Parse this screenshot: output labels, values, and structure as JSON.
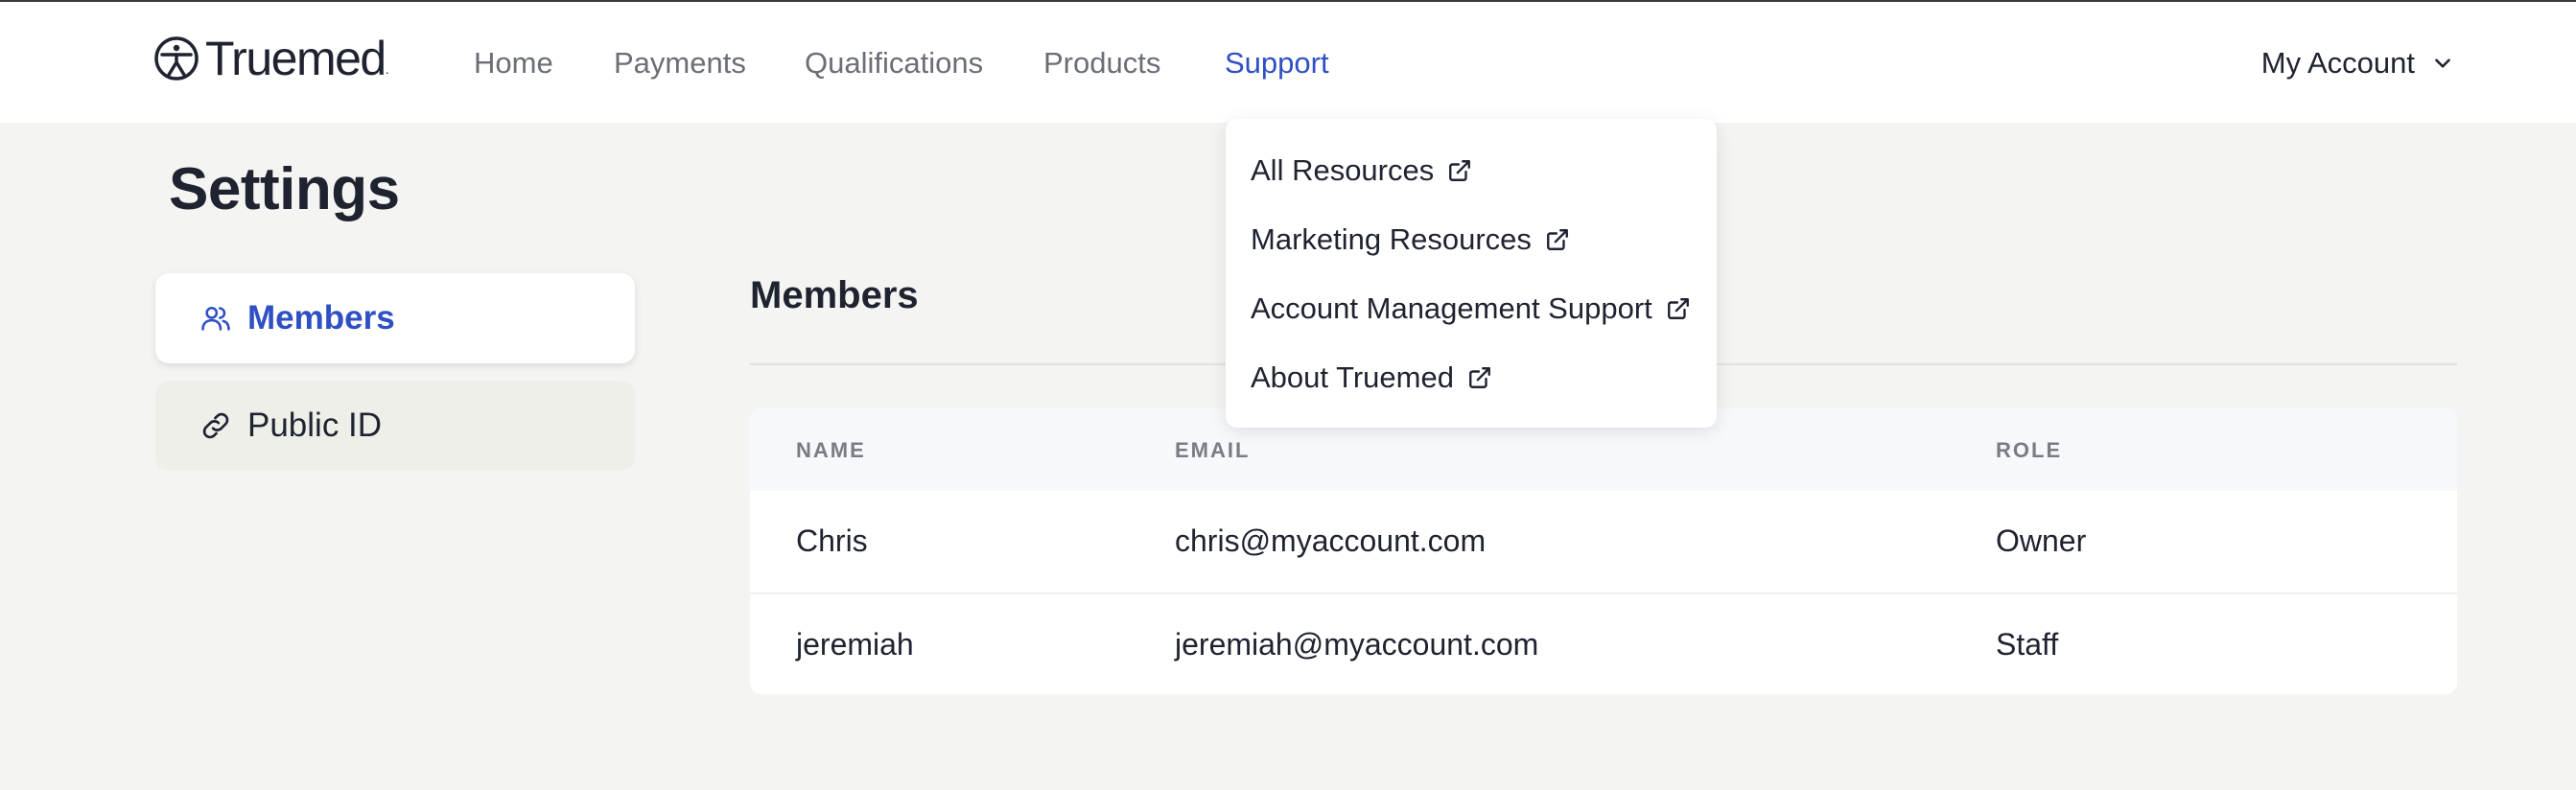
{
  "brand": {
    "name": "Truemed",
    "mark": "."
  },
  "nav": {
    "items": [
      {
        "label": "Home"
      },
      {
        "label": "Payments"
      },
      {
        "label": "Qualifications"
      },
      {
        "label": "Products"
      },
      {
        "label": "Support",
        "active": true
      }
    ],
    "account_label": "My Account"
  },
  "support_menu": {
    "items": [
      {
        "label": "All Resources",
        "icon": "external-link-icon"
      },
      {
        "label": "Marketing Resources",
        "icon": "external-link-icon"
      },
      {
        "label": "Account Management Support",
        "icon": "external-link-icon"
      },
      {
        "label": "About Truemed",
        "icon": "external-link-icon"
      }
    ]
  },
  "page": {
    "title": "Settings"
  },
  "sidebar": {
    "items": [
      {
        "label": "Members",
        "icon": "users-icon",
        "active": true
      },
      {
        "label": "Public ID",
        "icon": "link-icon",
        "active": false
      }
    ]
  },
  "members": {
    "title": "Members",
    "columns": [
      "NAME",
      "EMAIL",
      "ROLE"
    ],
    "rows": [
      {
        "name": "Chris",
        "email": "chris@myaccount.com",
        "role": "Owner"
      },
      {
        "name": "jeremiah",
        "email": "jeremiah@myaccount.com",
        "role": "Staff"
      }
    ]
  },
  "colors": {
    "accent": "#2f4fc4",
    "text": "#1f2330",
    "muted": "#6b6e76",
    "background": "#f4f4f2"
  }
}
